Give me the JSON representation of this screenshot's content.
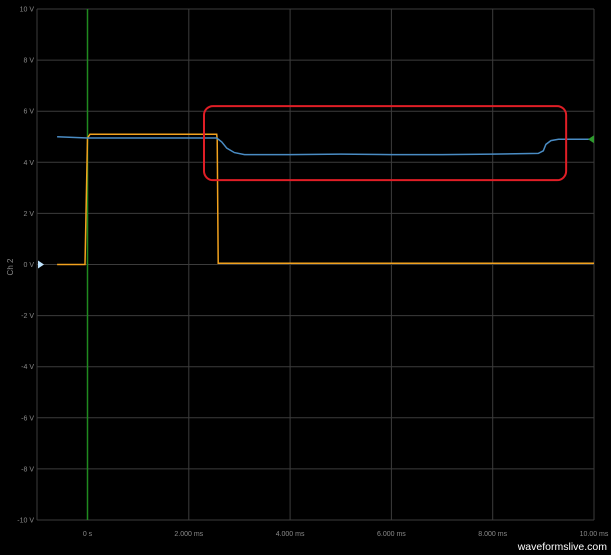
{
  "axis_label": "Ch 2",
  "watermark": "waveformslive.com",
  "y_ticks": [
    "10 V",
    "8 V",
    "6 V",
    "4 V",
    "2 V",
    "0 V",
    "-2 V",
    "-4 V",
    "-6 V",
    "-8 V",
    "-10 V"
  ],
  "x_ticks": [
    "0 s",
    "2.000 ms",
    "4.000 ms",
    "6.000 ms",
    "8.000 ms",
    "10.00 ms"
  ],
  "colors": {
    "background": "#000000",
    "grid": "#3c3c3c",
    "trigger_line": "#1f8a1f",
    "ch1": "#f2a21e",
    "ch2": "#4a8cc4",
    "highlight": "#e01e26"
  },
  "chart_data": {
    "type": "line",
    "xlabel": "",
    "ylabel": "Ch 2",
    "xlim_ms": [
      -0.6,
      10.0
    ],
    "ylim_V": [
      -10,
      10
    ],
    "grid": true,
    "trigger_time_ms": 0,
    "series": [
      {
        "x_ms": [
          -0.6,
          -0.05,
          0.0,
          0.05,
          2.55,
          2.56,
          2.58,
          10.0
        ],
        "y_V": [
          0.0,
          0.0,
          4.95,
          5.1,
          5.1,
          4.9,
          0.05,
          0.05
        ]
      },
      {
        "x_ms": [
          -0.6,
          0.0,
          2.55,
          2.65,
          2.75,
          2.9,
          3.1,
          4.0,
          5.0,
          6.0,
          7.0,
          8.0,
          8.9,
          9.0,
          9.05,
          9.15,
          9.3,
          10.0
        ],
        "y_V": [
          5.0,
          4.95,
          4.95,
          4.8,
          4.55,
          4.38,
          4.3,
          4.3,
          4.32,
          4.3,
          4.3,
          4.32,
          4.35,
          4.45,
          4.7,
          4.85,
          4.9,
          4.9
        ]
      }
    ],
    "annotation": {
      "type": "rounded-rectangle",
      "x_ms": [
        2.3,
        9.45
      ],
      "y_V": [
        3.3,
        6.2
      ]
    }
  }
}
